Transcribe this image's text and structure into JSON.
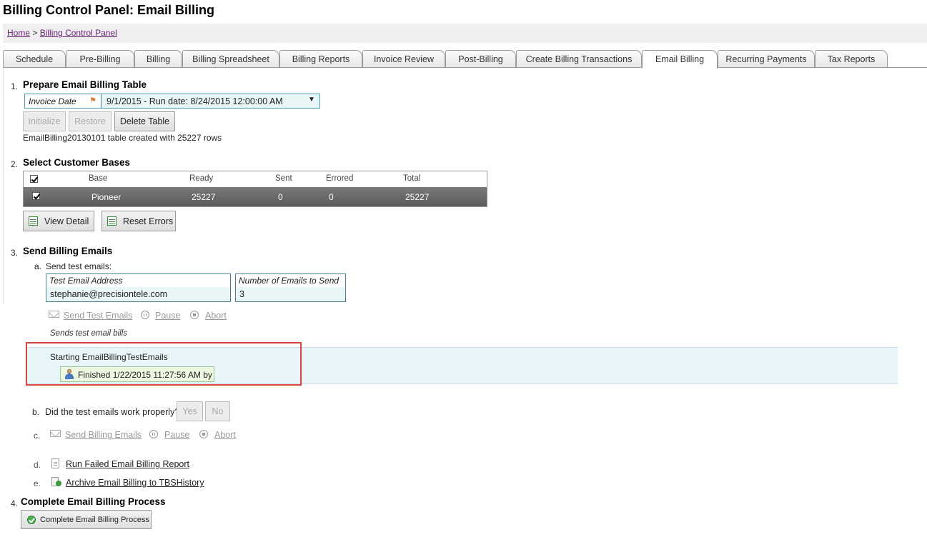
{
  "page": {
    "title": "Billing Control Panel: Email Billing"
  },
  "breadcrumb": {
    "home": "Home",
    "separator": ">",
    "current": "Billing Control Panel"
  },
  "tabs": [
    {
      "label": "Schedule"
    },
    {
      "label": "Pre-Billing"
    },
    {
      "label": "Billing"
    },
    {
      "label": "Billing Spreadsheet"
    },
    {
      "label": "Billing Reports"
    },
    {
      "label": "Invoice Review"
    },
    {
      "label": "Post-Billing"
    },
    {
      "label": "Create Billing Transactions"
    },
    {
      "label": "Email Billing",
      "active": true
    },
    {
      "label": "Recurring Payments"
    },
    {
      "label": "Tax Reports"
    }
  ],
  "step1": {
    "num": "1.",
    "title": "Prepare Email Billing Table",
    "invoice_date_label": "Invoice Date",
    "invoice_date_value": "9/1/2015 - Run date: 8/24/2015 12:00:00 AM",
    "initialize": "Initialize",
    "restore": "Restore",
    "delete_table": "Delete Table",
    "status": "EmailBilling20130101 table created with 25227 rows"
  },
  "step2": {
    "num": "2.",
    "title": "Select Customer Bases",
    "columns": [
      "Base",
      "Ready",
      "Sent",
      "Errored",
      "Total"
    ],
    "rows": [
      {
        "base": "Pioneer",
        "ready": "25227",
        "sent": "0",
        "errored": "0",
        "total": "25227"
      }
    ],
    "view_detail": "View Detail",
    "reset_errors": "Reset Errors"
  },
  "step3": {
    "num": "3.",
    "title": "Send Billing Emails",
    "a_label": "a.",
    "a_text": "Send test emails:",
    "test_email_label": "Test Email Address",
    "test_email_value": "stephanie@precisiontele.com",
    "num_emails_label": "Number of Emails to Send",
    "num_emails_value": "3",
    "send_test_emails": "Send Test Emails",
    "pause": "Pause",
    "abort": "Abort",
    "hint": "Sends test email bills",
    "log_line": "Starting EmailBillingTestEmails",
    "finished": "Finished 1/22/2015 11:27:56 AM by",
    "b_label": "b.",
    "b_text": "Did the test emails work properly?",
    "yes": "Yes",
    "no": "No",
    "c_label": "c.",
    "send_billing_emails": "Send Billing Emails",
    "d_label": "d.",
    "run_failed_report": "Run Failed Email Billing Report",
    "e_label": "e.",
    "archive": "Archive Email Billing to TBSHistory"
  },
  "step4": {
    "num": "4.",
    "title": "Complete Email Billing Process",
    "button": "Complete Email Billing Process"
  },
  "colors": {
    "highlight": "#d9443c",
    "field_bg": "#e8f6f8",
    "grid_row": "#6a6a6a"
  }
}
